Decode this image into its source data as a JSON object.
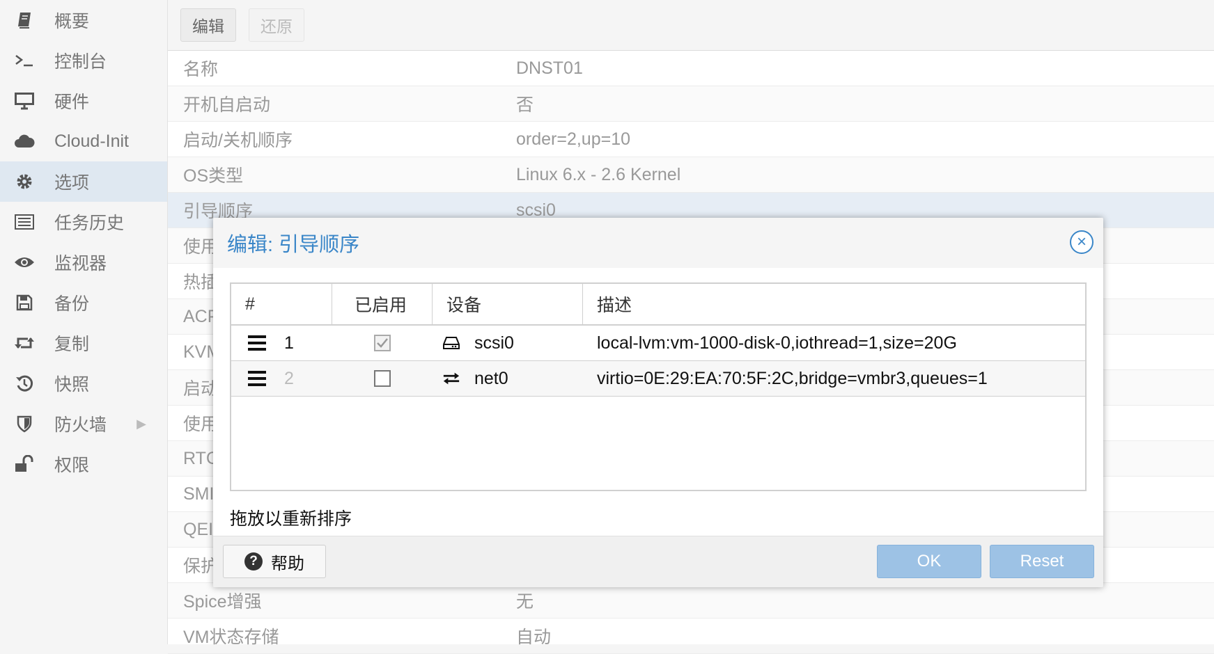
{
  "sidebar": {
    "items": [
      {
        "label": "概要",
        "icon": "book-icon"
      },
      {
        "label": "控制台",
        "icon": "terminal-icon"
      },
      {
        "label": "硬件",
        "icon": "monitor-icon"
      },
      {
        "label": "Cloud-Init",
        "icon": "cloud-icon"
      },
      {
        "label": "选项",
        "icon": "gear-icon",
        "active": true
      },
      {
        "label": "任务历史",
        "icon": "list-icon"
      },
      {
        "label": "监视器",
        "icon": "eye-icon"
      },
      {
        "label": "备份",
        "icon": "floppy-icon"
      },
      {
        "label": "复制",
        "icon": "retweet-icon"
      },
      {
        "label": "快照",
        "icon": "history-icon"
      },
      {
        "label": "防火墙",
        "icon": "shield-icon"
      },
      {
        "label": "权限",
        "icon": "unlock-icon"
      }
    ]
  },
  "toolbar": {
    "edit_label": "编辑",
    "revert_label": "还原"
  },
  "options": [
    {
      "key": "名称",
      "value": "DNST01"
    },
    {
      "key": "开机自启动",
      "value": "否"
    },
    {
      "key": "启动/关机顺序",
      "value": "order=2,up=10"
    },
    {
      "key": "OS类型",
      "value": "Linux 6.x - 2.6 Kernel"
    },
    {
      "key": "引导顺序",
      "value": "scsi0"
    },
    {
      "key": "使用",
      "value": ""
    },
    {
      "key": "热插",
      "value": ""
    },
    {
      "key": "ACP",
      "value": ""
    },
    {
      "key": "KVM",
      "value": ""
    },
    {
      "key": "启动",
      "value": ""
    },
    {
      "key": "使用",
      "value": ""
    },
    {
      "key": "RTC",
      "value": ""
    },
    {
      "key": "SMI",
      "value": ""
    },
    {
      "key": "QEI",
      "value": ""
    },
    {
      "key": "保护",
      "value": ""
    },
    {
      "key": "Spice增强",
      "value": "无"
    },
    {
      "key": "VM状态存储",
      "value": "自动"
    }
  ],
  "dialog": {
    "title": "编辑: 引导顺序",
    "columns": {
      "num": "#",
      "enabled": "已启用",
      "device": "设备",
      "desc": "描述"
    },
    "rows": [
      {
        "num": "1",
        "enabled": true,
        "device": "scsi0",
        "device_icon": "harddisk-icon",
        "desc": "local-lvm:vm-1000-disk-0,iothread=1,size=20G"
      },
      {
        "num": "2",
        "enabled": false,
        "device": "net0",
        "device_icon": "exchange-icon",
        "desc": "virtio=0E:29:EA:70:5F:2C,bridge=vmbr3,queues=1"
      }
    ],
    "hint": "拖放以重新排序",
    "help_label": "帮助",
    "ok_label": "OK",
    "reset_label": "Reset"
  },
  "colors": {
    "accent": "#3a86c8",
    "button_primary": "#9dc2e5",
    "selected_row": "#e6edf5",
    "active_nav": "#dfe8f1"
  }
}
